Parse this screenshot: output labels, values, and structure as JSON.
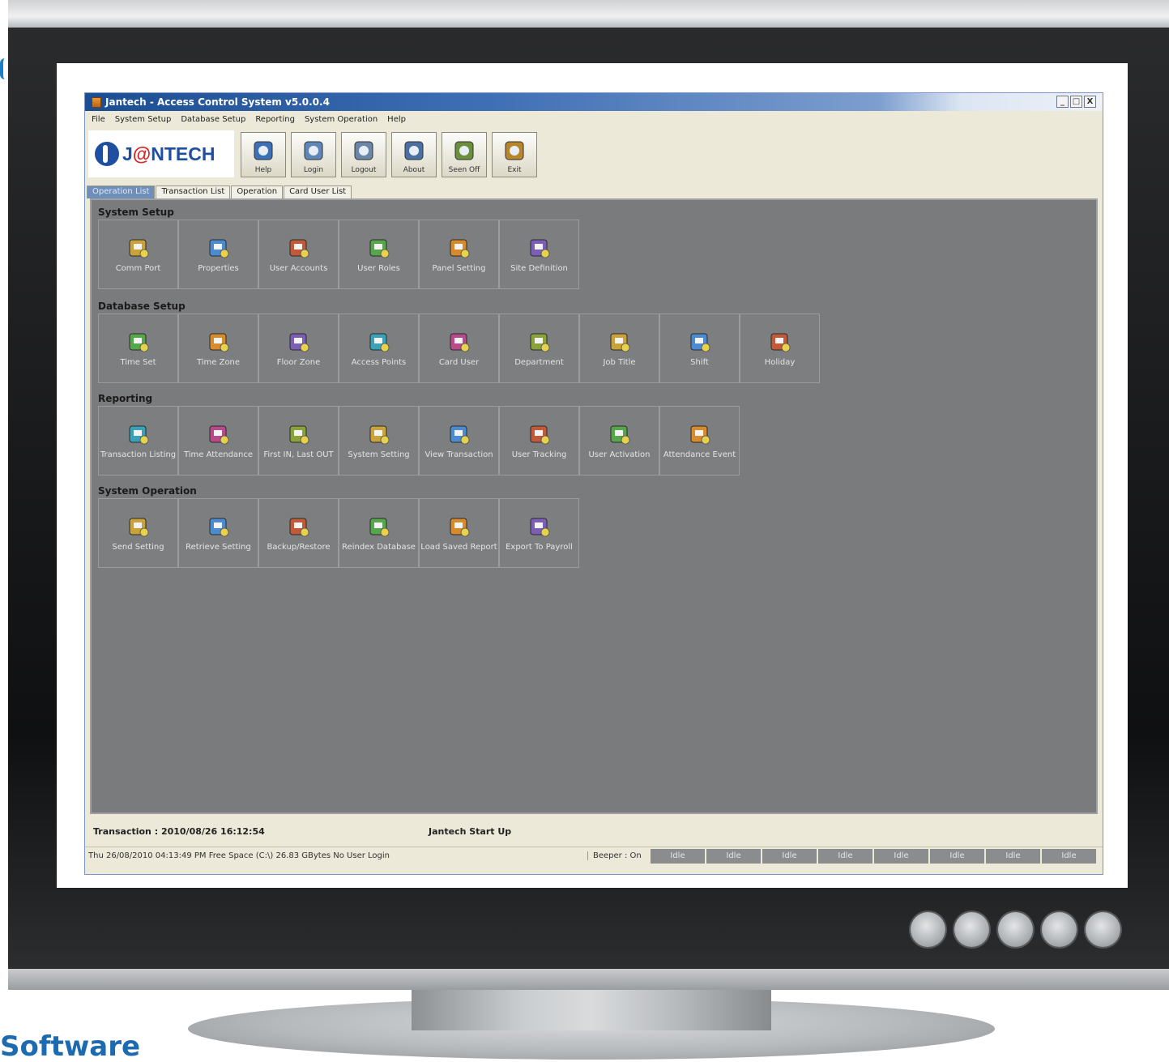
{
  "window": {
    "title": "Jantech - Access Control System v5.0.0.4",
    "controls": [
      "_",
      "□",
      "X"
    ]
  },
  "menu": [
    "File",
    "System Setup",
    "Database Setup",
    "Reporting",
    "System Operation",
    "Help"
  ],
  "logo": {
    "prefix": "J",
    "at": "@",
    "suffix": "NTECH"
  },
  "toolbar": [
    {
      "label": "Help",
      "icon": "help-book-icon"
    },
    {
      "label": "Login",
      "icon": "login-icon"
    },
    {
      "label": "Logout",
      "icon": "logout-icon"
    },
    {
      "label": "About",
      "icon": "about-icon"
    },
    {
      "label": "Seen Off",
      "icon": "seen-off-icon"
    },
    {
      "label": "Exit",
      "icon": "exit-door-icon"
    }
  ],
  "tabs": [
    "Operation List",
    "Transaction List",
    "Operation",
    "Card User List"
  ],
  "groups": [
    {
      "title": "System Setup",
      "items": [
        "Comm Port",
        "Properties",
        "User Accounts",
        "User Roles",
        "Panel Setting",
        "Site Definition"
      ]
    },
    {
      "title": "Database Setup",
      "items": [
        "Time Set",
        "Time Zone",
        "Floor Zone",
        "Access Points",
        "Card User",
        "Department",
        "Job Title",
        "Shift",
        "Holiday"
      ]
    },
    {
      "title": "Reporting",
      "items": [
        "Transaction Listing",
        "Time Attendance",
        "First IN, Last OUT",
        "System Setting",
        "View Transaction",
        "User Tracking",
        "User Activation",
        "Attendance Event"
      ]
    },
    {
      "title": "System Operation",
      "items": [
        "Send Setting",
        "Retrieve Setting",
        "Backup/Restore",
        "Reindex Database",
        "Load Saved Report",
        "Export To Payroll"
      ]
    }
  ],
  "status": {
    "transaction": "Transaction : 2010/08/26 16:12:54",
    "center": "Jantech Start Up",
    "info": "Thu 26/08/2010 04:13:49 PM  Free Space (C:\\) 26.83  GBytes  No User Login",
    "beeper": "Beeper : On",
    "idle": [
      "Idle",
      "Idle",
      "Idle",
      "Idle",
      "Idle",
      "Idle",
      "Idle",
      "Idle"
    ]
  },
  "caption": "Software",
  "colors": {
    "accent": "#1c6bb0",
    "titlebar": "#1b4d92",
    "panel": "#7a7b7d"
  }
}
